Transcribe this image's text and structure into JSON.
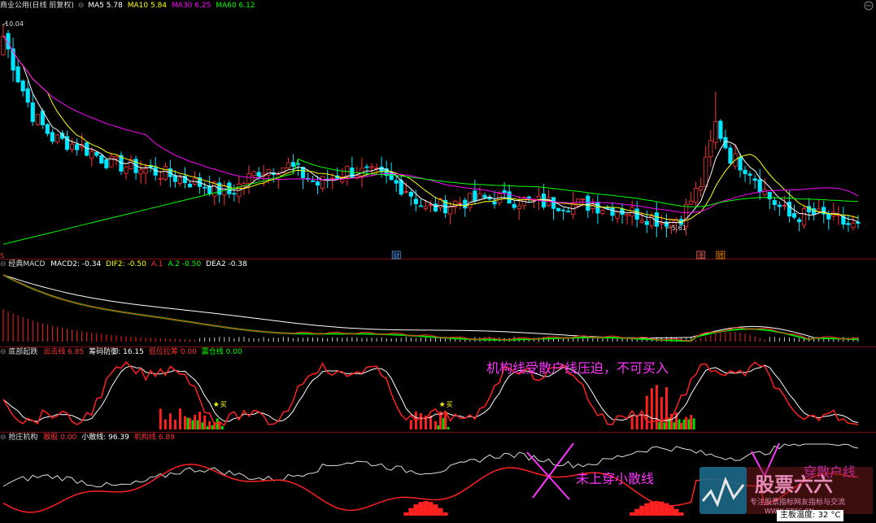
{
  "stock": {
    "name": "商业公用(日线 前复权)"
  },
  "ma_legend": [
    {
      "label": "MA5",
      "value": "5.78",
      "color": "#ffffff"
    },
    {
      "label": "MA10",
      "value": "5.84",
      "color": "#ffff00"
    },
    {
      "label": "MA30",
      "value": "6.25",
      "color": "#ff00ff"
    },
    {
      "label": "MA60",
      "value": "6.12",
      "color": "#00ff00"
    }
  ],
  "price_panel": {
    "high_label": "10.04",
    "low_label": "5.61",
    "ylim": [
      5.2,
      10.3
    ],
    "markers": [
      {
        "label": "S",
        "x_index": 0,
        "color": "#ff3333"
      },
      {
        "label": "财",
        "x_index": 80,
        "color": "#4aa3ff",
        "boxed": true
      },
      {
        "label": "涨",
        "x_index": 142,
        "color": "#ff6666",
        "boxed": true
      },
      {
        "label": "转",
        "x_index": 146,
        "color": "#ff8800",
        "boxed": true
      }
    ]
  },
  "macd_panel": {
    "title": "经典MACD",
    "params": [
      {
        "label": "MACD2:",
        "value": "-0.34",
        "color": "#ffffff"
      },
      {
        "label": "DIF2:",
        "value": "-0.50",
        "color": "#ffff00"
      },
      {
        "label": "A.1",
        "value": "",
        "color": "#ff3333"
      },
      {
        "label": "A.2",
        "value": "-0.50",
        "color": "#00ff00"
      },
      {
        "label": "DEA2",
        "value": "-0.38",
        "color": "#ffffff"
      }
    ]
  },
  "bottom_panel": {
    "title": "底部起跌",
    "params": [
      {
        "label": "出击线",
        "value": "6.85",
        "color": "#ff3333"
      },
      {
        "label": "筹码防御:",
        "value": "16.15",
        "color": "#ffffff"
      },
      {
        "label": "低位拉筹",
        "value": "0.00",
        "color": "#ff3333"
      },
      {
        "label": "震仓线",
        "value": "0.00",
        "color": "#00ff00"
      }
    ],
    "buy_label": "买",
    "annotation": "机构线受散户线压迫，不可买入"
  },
  "chip_panel": {
    "title": "抢庄机构",
    "params": [
      {
        "label": "散股",
        "value": "0.00",
        "color": "#ff3333"
      },
      {
        "label": "小散线:",
        "value": "96.39",
        "color": "#ffffff"
      },
      {
        "label": "机构线",
        "value": "6.89",
        "color": "#ff3333"
      }
    ],
    "annotation": "未上穿小散线",
    "annotation2": "穿散户线"
  },
  "watermark": {
    "brand": "股票六六",
    "slogan": "专注股票指标网友指标与交流",
    "url": "WWW.GP66.CN"
  },
  "status": {
    "temp_label": "主板温度:",
    "temp_value": "32",
    "temp_unit": "°C"
  },
  "colors": {
    "up": "#ff3333",
    "down": "#00e5ff",
    "ma5": "#ffffff",
    "ma10": "#ffff00",
    "ma30": "#ff00ff",
    "ma60": "#00ff00",
    "red": "#ff2020",
    "green": "#00dd00",
    "divider": "#7a1010",
    "annotation": "#ff33ff"
  }
}
